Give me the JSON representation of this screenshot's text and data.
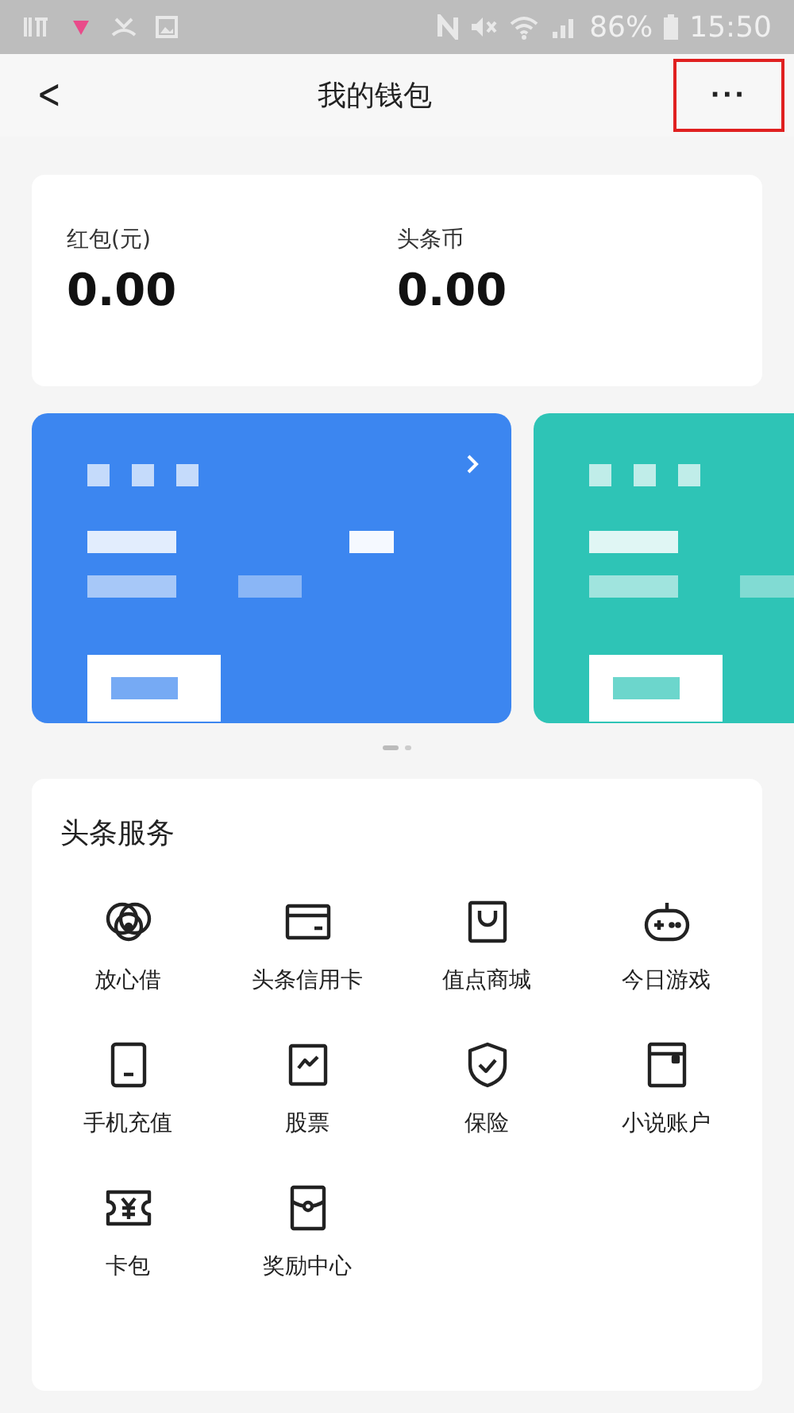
{
  "status_bar": {
    "battery": "86%",
    "time": "15:50"
  },
  "header": {
    "title": "我的钱包",
    "back": "<",
    "more": "···",
    "more_highlighted": true
  },
  "balances": [
    {
      "label": "红包(元)",
      "value": "0.00"
    },
    {
      "label": "头条币",
      "value": "0.00"
    }
  ],
  "cards": [
    {
      "color": "#3c86f0"
    },
    {
      "color": "#2ec4b6"
    }
  ],
  "pager": [
    {
      "selected": true
    },
    {
      "selected": false
    }
  ],
  "services": {
    "title": "头条服务",
    "items": [
      {
        "kind": "coins",
        "label": "放心借"
      },
      {
        "kind": "card",
        "label": "头条信用卡"
      },
      {
        "kind": "bag",
        "label": "值点商城"
      },
      {
        "kind": "gamepad",
        "label": "今日游戏"
      },
      {
        "kind": "phone",
        "label": "手机充值"
      },
      {
        "kind": "chart",
        "label": "股票"
      },
      {
        "kind": "shield",
        "label": "保险"
      },
      {
        "kind": "book",
        "label": "小说账户"
      },
      {
        "kind": "ticket",
        "label": "卡包"
      },
      {
        "kind": "envelope",
        "label": "奖励中心"
      }
    ]
  }
}
